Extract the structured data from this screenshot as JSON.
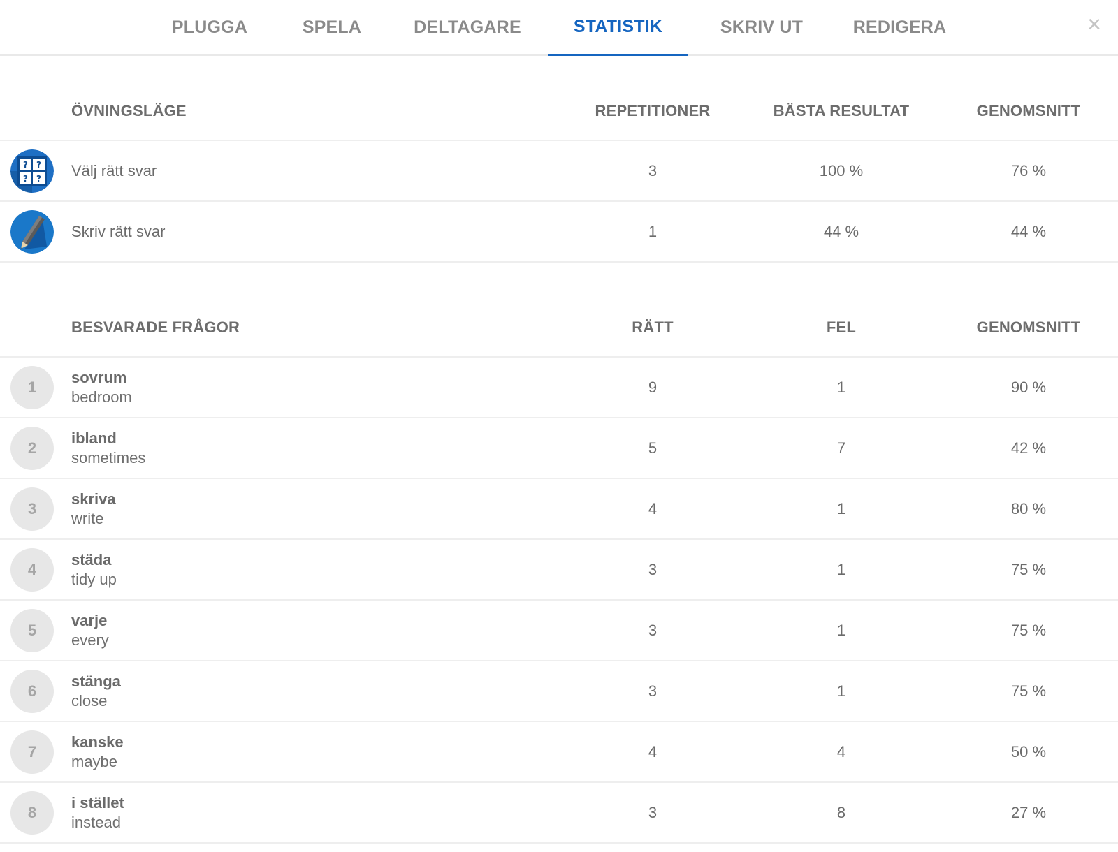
{
  "nav": {
    "tabs": [
      {
        "label": "PLUGGA"
      },
      {
        "label": "SPELA"
      },
      {
        "label": "DELTAGARE"
      },
      {
        "label": "STATISTIK"
      },
      {
        "label": "SKRIV UT"
      },
      {
        "label": "REDIGERA"
      }
    ],
    "active_tab": "STATISTIK",
    "close_symbol": "×"
  },
  "modes": {
    "headers": {
      "name": "ÖVNINGSLÄGE",
      "col1": "REPETITIONER",
      "col2": "BÄSTA RESULTAT",
      "col3": "GENOMSNITT"
    },
    "rows": [
      {
        "icon": "multiple-choice-icon",
        "name": "Välj rätt svar",
        "repetitions": "3",
        "best": "100 %",
        "average": "76 %"
      },
      {
        "icon": "pencil-icon",
        "name": "Skriv rätt svar",
        "repetitions": "1",
        "best": "44 %",
        "average": "44 %"
      }
    ]
  },
  "questions": {
    "headers": {
      "name": "BESVARADE FRÅGOR",
      "col1": "RÄTT",
      "col2": "FEL",
      "col3": "GENOMSNITT"
    },
    "rows": [
      {
        "num": "1",
        "term": "sovrum",
        "def": "bedroom",
        "right": "9",
        "wrong": "1",
        "average": "90 %"
      },
      {
        "num": "2",
        "term": "ibland",
        "def": "sometimes",
        "right": "5",
        "wrong": "7",
        "average": "42 %"
      },
      {
        "num": "3",
        "term": "skriva",
        "def": "write",
        "right": "4",
        "wrong": "1",
        "average": "80 %"
      },
      {
        "num": "4",
        "term": "städa",
        "def": "tidy up",
        "right": "3",
        "wrong": "1",
        "average": "75 %"
      },
      {
        "num": "5",
        "term": "varje",
        "def": "every",
        "right": "3",
        "wrong": "1",
        "average": "75 %"
      },
      {
        "num": "6",
        "term": "stänga",
        "def": "close",
        "right": "3",
        "wrong": "1",
        "average": "75 %"
      },
      {
        "num": "7",
        "term": "kanske",
        "def": "maybe",
        "right": "4",
        "wrong": "4",
        "average": "50 %"
      },
      {
        "num": "8",
        "term": "i stället",
        "def": "instead",
        "right": "3",
        "wrong": "8",
        "average": "27 %"
      }
    ]
  },
  "colors": {
    "accent": "#1565c0",
    "icon_blue": "#1e6fc4",
    "badge_bg": "#e7e7e7"
  }
}
